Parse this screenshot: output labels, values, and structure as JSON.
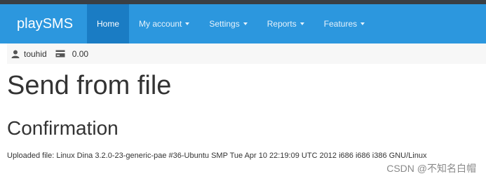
{
  "navbar": {
    "brand": "playSMS",
    "items": [
      {
        "label": "Home",
        "active": true,
        "dropdown": false
      },
      {
        "label": "My account",
        "active": false,
        "dropdown": true
      },
      {
        "label": "Settings",
        "active": false,
        "dropdown": true
      },
      {
        "label": "Reports",
        "active": false,
        "dropdown": true
      },
      {
        "label": "Features",
        "active": false,
        "dropdown": true
      }
    ],
    "color": "#2c97de",
    "active_color": "#1a7cc4"
  },
  "userbar": {
    "username": "touhid",
    "credit": "0.00",
    "user_icon": "user-icon",
    "credit_icon": "credit-card-icon"
  },
  "main": {
    "title": "Send from file",
    "section_title": "Confirmation",
    "uploaded_file": "Uploaded file: Linux Dina 3.2.0-23-generic-pae #36-Ubuntu SMP Tue Apr 10 22:19:09 UTC 2012 i686 i686 i386 GNU/Linux"
  },
  "watermark": "CSDN @不知名白帽"
}
